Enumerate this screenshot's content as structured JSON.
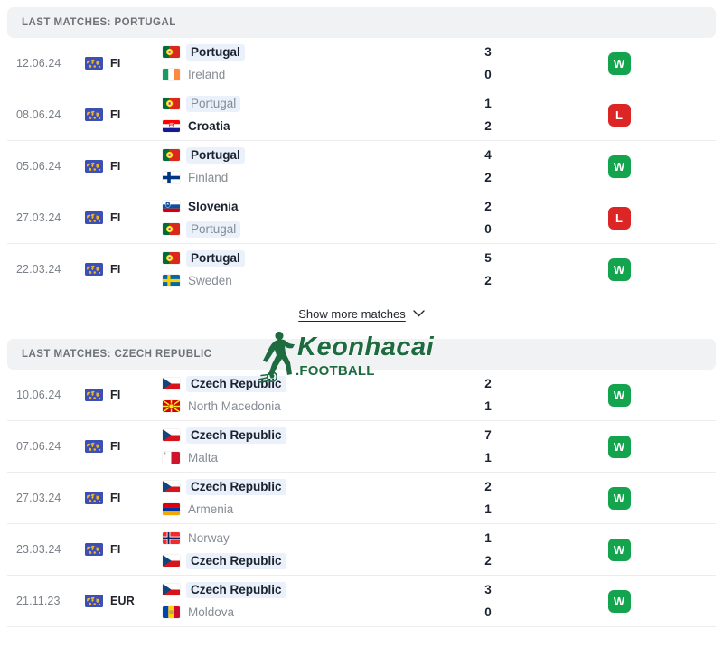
{
  "sections": [
    {
      "header": "LAST MATCHES: PORTUGAL",
      "focus_team": "Portugal",
      "matches": [
        {
          "date": "12.06.24",
          "competition": "FI",
          "competition_icon": "world-flag-icon",
          "home": {
            "team": "Portugal",
            "flag": "portugal",
            "winner": true,
            "highlight": true
          },
          "away": {
            "team": "Ireland",
            "flag": "ireland",
            "winner": false,
            "highlight": false
          },
          "home_score": "3",
          "away_score": "0",
          "result": "W"
        },
        {
          "date": "08.06.24",
          "competition": "FI",
          "competition_icon": "world-flag-icon",
          "home": {
            "team": "Portugal",
            "flag": "portugal",
            "winner": false,
            "highlight": true
          },
          "away": {
            "team": "Croatia",
            "flag": "croatia",
            "winner": true,
            "highlight": false
          },
          "home_score": "1",
          "away_score": "2",
          "result": "L"
        },
        {
          "date": "05.06.24",
          "competition": "FI",
          "competition_icon": "world-flag-icon",
          "home": {
            "team": "Portugal",
            "flag": "portugal",
            "winner": true,
            "highlight": true
          },
          "away": {
            "team": "Finland",
            "flag": "finland",
            "winner": false,
            "highlight": false
          },
          "home_score": "4",
          "away_score": "2",
          "result": "W"
        },
        {
          "date": "27.03.24",
          "competition": "FI",
          "competition_icon": "world-flag-icon",
          "home": {
            "team": "Slovenia",
            "flag": "slovenia",
            "winner": true,
            "highlight": false
          },
          "away": {
            "team": "Portugal",
            "flag": "portugal",
            "winner": false,
            "highlight": true
          },
          "home_score": "2",
          "away_score": "0",
          "result": "L"
        },
        {
          "date": "22.03.24",
          "competition": "FI",
          "competition_icon": "world-flag-icon",
          "home": {
            "team": "Portugal",
            "flag": "portugal",
            "winner": true,
            "highlight": true
          },
          "away": {
            "team": "Sweden",
            "flag": "sweden",
            "winner": false,
            "highlight": false
          },
          "home_score": "5",
          "away_score": "2",
          "result": "W"
        }
      ],
      "show_more": {
        "label": "Show more matches",
        "icon": "chevron-down-icon"
      }
    },
    {
      "header": "LAST MATCHES: CZECH REPUBLIC",
      "focus_team": "Czech Republic",
      "matches": [
        {
          "date": "10.06.24",
          "competition": "FI",
          "competition_icon": "world-flag-icon",
          "home": {
            "team": "Czech Republic",
            "flag": "czech",
            "winner": true,
            "highlight": true
          },
          "away": {
            "team": "North Macedonia",
            "flag": "north-macedonia",
            "winner": false,
            "highlight": false
          },
          "home_score": "2",
          "away_score": "1",
          "result": "W"
        },
        {
          "date": "07.06.24",
          "competition": "FI",
          "competition_icon": "world-flag-icon",
          "home": {
            "team": "Czech Republic",
            "flag": "czech",
            "winner": true,
            "highlight": true
          },
          "away": {
            "team": "Malta",
            "flag": "malta",
            "winner": false,
            "highlight": false
          },
          "home_score": "7",
          "away_score": "1",
          "result": "W"
        },
        {
          "date": "27.03.24",
          "competition": "FI",
          "competition_icon": "world-flag-icon",
          "home": {
            "team": "Czech Republic",
            "flag": "czech",
            "winner": true,
            "highlight": true
          },
          "away": {
            "team": "Armenia",
            "flag": "armenia",
            "winner": false,
            "highlight": false
          },
          "home_score": "2",
          "away_score": "1",
          "result": "W"
        },
        {
          "date": "23.03.24",
          "competition": "FI",
          "competition_icon": "world-flag-icon",
          "home": {
            "team": "Norway",
            "flag": "norway",
            "winner": false,
            "highlight": false
          },
          "away": {
            "team": "Czech Republic",
            "flag": "czech",
            "winner": true,
            "highlight": true
          },
          "home_score": "1",
          "away_score": "2",
          "result": "W"
        },
        {
          "date": "21.11.23",
          "competition": "EUR",
          "competition_icon": "world-flag-icon",
          "home": {
            "team": "Czech Republic",
            "flag": "czech",
            "winner": true,
            "highlight": true
          },
          "away": {
            "team": "Moldova",
            "flag": "moldova",
            "winner": false,
            "highlight": false
          },
          "home_score": "3",
          "away_score": "0",
          "result": "W"
        }
      ]
    }
  ],
  "watermark": {
    "brand": "Keonhacai",
    "suffix": ".FOOTBALL",
    "color": "#1d6b3f"
  },
  "colors": {
    "win": "#14a44d",
    "loss": "#dc2626",
    "header_band": "#f1f2f4",
    "highlight": "#eaf1fb",
    "muted_text": "#868c95",
    "strong_text": "#1b2330"
  }
}
